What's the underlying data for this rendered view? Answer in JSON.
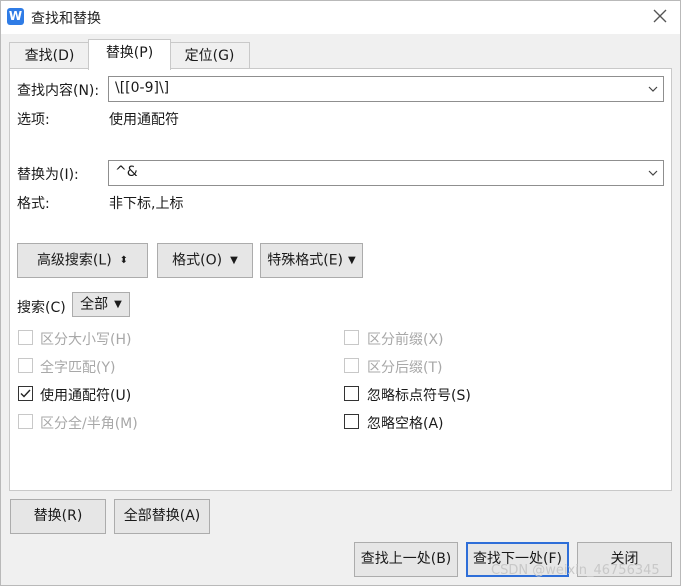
{
  "window": {
    "title": "查找和替换",
    "app_icon_letter": "W"
  },
  "tabs": [
    {
      "label": "查找(D)",
      "active": false
    },
    {
      "label": "替换(P)",
      "active": true
    },
    {
      "label": "定位(G)",
      "active": false
    }
  ],
  "find": {
    "label": "查找内容(N):",
    "value": "\\[[0-9]\\]",
    "options_label": "选项:",
    "options_value": "使用通配符"
  },
  "replace": {
    "label": "替换为(I):",
    "value": "^&",
    "format_label": "格式:",
    "format_value": "非下标,上标"
  },
  "buttons": {
    "advanced_search": "高级搜索(L)",
    "format": "格式(O)",
    "special_format": "特殊格式(E)",
    "replace": "替换(R)",
    "replace_all": "全部替换(A)",
    "find_prev": "查找上一处(B)",
    "find_next": "查找下一处(F)",
    "close": "关闭"
  },
  "search": {
    "label": "搜索(C)",
    "selected": "全部"
  },
  "checkboxes": {
    "match_case": {
      "label": "区分大小写(H)",
      "checked": false,
      "enabled": false
    },
    "whole_word": {
      "label": "全字匹配(Y)",
      "checked": false,
      "enabled": false
    },
    "use_wildcards": {
      "label": "使用通配符(U)",
      "checked": true,
      "enabled": true
    },
    "full_half_width": {
      "label": "区分全/半角(M)",
      "checked": false,
      "enabled": false
    },
    "match_prefix": {
      "label": "区分前缀(X)",
      "checked": false,
      "enabled": false
    },
    "match_suffix": {
      "label": "区分后缀(T)",
      "checked": false,
      "enabled": false
    },
    "ignore_punctuation": {
      "label": "忽略标点符号(S)",
      "checked": false,
      "enabled": true
    },
    "ignore_spaces": {
      "label": "忽略空格(A)",
      "checked": false,
      "enabled": true
    }
  },
  "watermark": "CSDN @weixin_46756345"
}
